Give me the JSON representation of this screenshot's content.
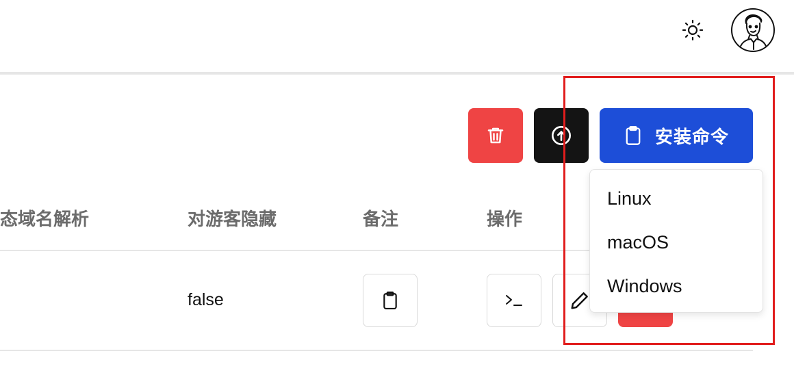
{
  "header": {
    "theme_toggle_icon": "sun-icon",
    "avatar_icon": "avatar-illustration"
  },
  "toolbar": {
    "delete_icon": "trash-icon",
    "upload_icon": "arrow-up-circle-icon",
    "install_label": "安装命令",
    "install_icon": "clipboard-icon",
    "colors": {
      "danger": "#ef4444",
      "dark": "#141414",
      "primary": "#1d4ed8"
    }
  },
  "table": {
    "headers": [
      "态域名解析",
      "对游客隐藏",
      "备注",
      "操作"
    ],
    "rows": [
      {
        "hide_from_guest": "false"
      }
    ]
  },
  "install_menu": {
    "options": [
      "Linux",
      "macOS",
      "Windows"
    ]
  },
  "highlight_color": "#e11d1d"
}
